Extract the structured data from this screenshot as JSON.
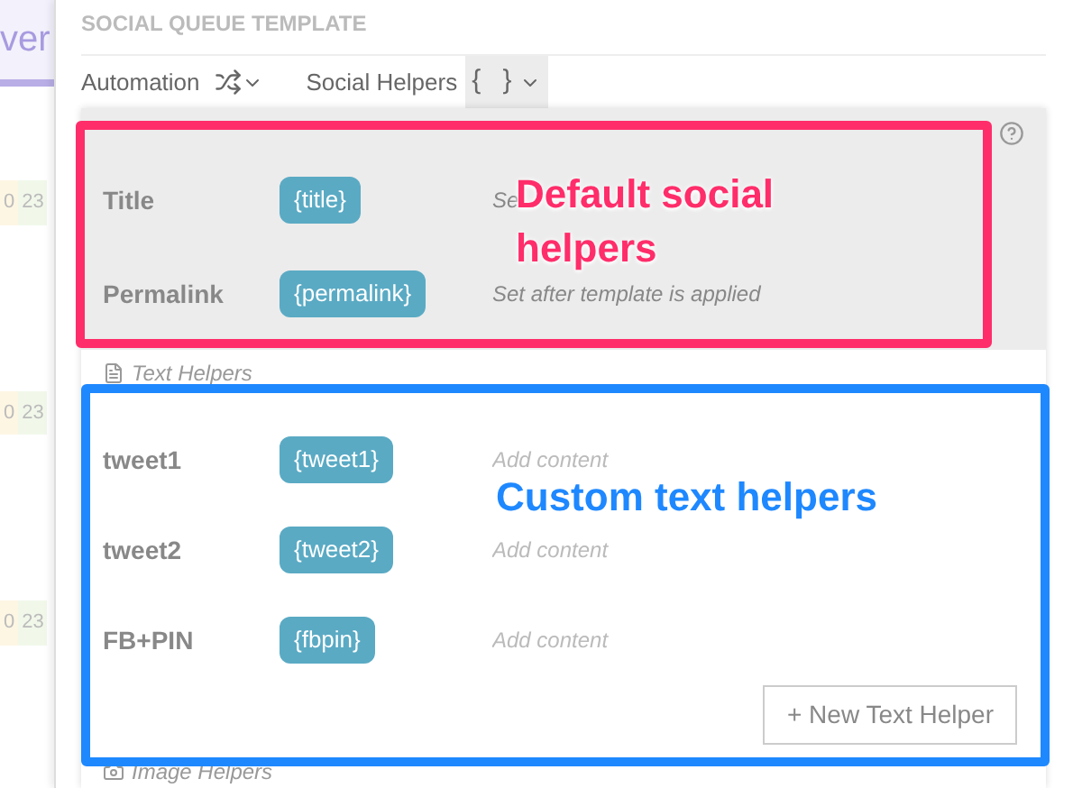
{
  "background": {
    "title": "ver",
    "cells": [
      [
        "0",
        "23"
      ],
      [
        "0",
        "23"
      ],
      [
        "0",
        "23"
      ]
    ]
  },
  "panel": {
    "title": "SOCIAL QUEUE TEMPLATE",
    "toolbar": [
      {
        "label": "Automation",
        "kind": "shuffle"
      },
      {
        "label": "Social Helpers",
        "kind": "braces",
        "icon": "{ }",
        "selected": true
      }
    ]
  },
  "helpers": {
    "default_rows": [
      {
        "name": "Title",
        "tag": "{title}",
        "content": "Se"
      },
      {
        "name": "Permalink",
        "tag": "{permalink}",
        "content": "Set after template is applied"
      }
    ],
    "text_section": "Text Helpers",
    "text_rows": [
      {
        "name": "tweet1",
        "tag": "{tweet1}",
        "placeholder": "Add content"
      },
      {
        "name": "tweet2",
        "tag": "{tweet2}",
        "placeholder": "Add content"
      },
      {
        "name": "FB+PIN",
        "tag": "{fbpin}",
        "placeholder": "Add content"
      }
    ],
    "new_button": "+ New Text Helper",
    "image_section": "Image Helpers"
  },
  "annotations": [
    {
      "text": "Default social helpers",
      "color": "#ff2d6a"
    },
    {
      "text": "Custom text helpers",
      "color": "#1e88ff"
    }
  ]
}
